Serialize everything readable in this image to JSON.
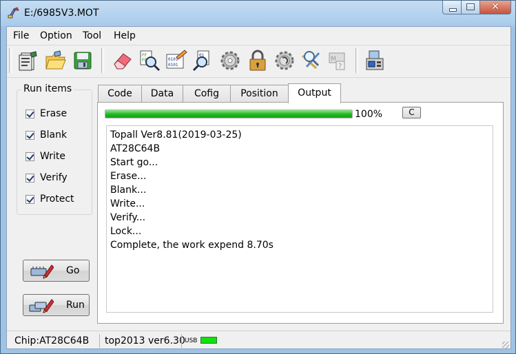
{
  "window": {
    "title": "E:/6985V3.MOT",
    "close_glyph": "✕"
  },
  "menu": [
    "File",
    "Option",
    "Tool",
    "Help"
  ],
  "toolbar": {
    "icons": [
      "report-icon",
      "open-folder-icon",
      "save-disk-icon",
      "eraser-icon",
      "blank-check-icon",
      "program-icon",
      "verify-icon",
      "config-gear-icon",
      "lock-icon",
      "settings-gear-icon",
      "search-chip-icon",
      "chip-help-icon",
      "device-icon"
    ]
  },
  "run_items": {
    "label": "Run items",
    "items": [
      {
        "label": "Erase",
        "checked": true
      },
      {
        "label": "Blank",
        "checked": true
      },
      {
        "label": "Write",
        "checked": true
      },
      {
        "label": "Verify",
        "checked": true
      },
      {
        "label": "Protect",
        "checked": true
      }
    ]
  },
  "buttons": {
    "go": "Go",
    "run": "Run",
    "c": "C"
  },
  "tabs": [
    "Code",
    "Data",
    "Cofig",
    "Position",
    "Output"
  ],
  "active_tab": "Output",
  "progress": {
    "value": 1.0,
    "text": "100%"
  },
  "output": [
    "Topall Ver8.81(2019-03-25)",
    "AT28C64B",
    "Start go...",
    "Erase...",
    "Blank...",
    "Write...",
    "Verify...",
    "Lock...",
    "Complete,  the work expend 8.70s"
  ],
  "status": {
    "chip": "Chip:AT28C64B",
    "version": "top2013 ver6.30",
    "usb_label": "USB",
    "usb_color": "#10e010"
  },
  "colors": {
    "progress_fill": "#1fb51f",
    "title_bar": "#a8cbeb"
  }
}
